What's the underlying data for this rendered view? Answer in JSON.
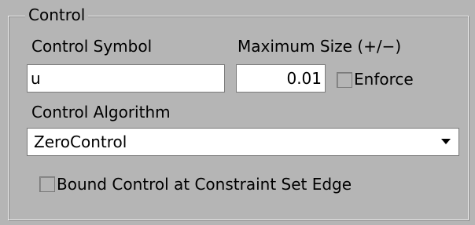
{
  "control_group": {
    "title": "Control"
  },
  "control_symbol": {
    "label": "Control Symbol",
    "value": "u"
  },
  "maximum_size": {
    "label": "Maximum Size (+/−)",
    "value": "0.01",
    "enforce_label": "Enforce",
    "enforce_checked": false
  },
  "control_algorithm": {
    "label": "Control Algorithm",
    "selected": "ZeroControl"
  },
  "bound_control": {
    "label": "Bound Control at Constraint Set Edge",
    "checked": false
  },
  "icons": {
    "dropdown": "chevron-down-icon"
  },
  "colors": {
    "panel_background": "#b5b5b5",
    "field_background": "#ffffff"
  }
}
